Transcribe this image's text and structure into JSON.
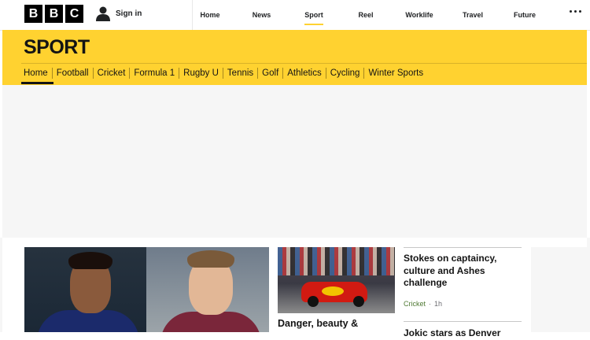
{
  "header": {
    "logo_letters": [
      "B",
      "B",
      "C"
    ],
    "sign_in": "Sign in",
    "nav": [
      {
        "label": "Home",
        "active": false
      },
      {
        "label": "News",
        "active": false
      },
      {
        "label": "Sport",
        "active": true
      },
      {
        "label": "Reel",
        "active": false
      },
      {
        "label": "Worklife",
        "active": false
      },
      {
        "label": "Travel",
        "active": false
      },
      {
        "label": "Future",
        "active": false
      }
    ],
    "more_icon": "more-dots-icon",
    "user_icon": "user-icon"
  },
  "sport": {
    "title": "SPORT",
    "subnav": [
      {
        "label": "Home",
        "active": true
      },
      {
        "label": "Football"
      },
      {
        "label": "Cricket"
      },
      {
        "label": "Formula 1"
      },
      {
        "label": "Rugby U"
      },
      {
        "label": "Tennis"
      },
      {
        "label": "Golf"
      },
      {
        "label": "Athletics"
      },
      {
        "label": "Cycling"
      },
      {
        "label": "Winter Sports"
      }
    ]
  },
  "stories": {
    "second": {
      "title": "Danger, beauty &"
    },
    "side1": {
      "title": "Stokes on captaincy, culture and Ashes challenge",
      "section": "Cricket",
      "separator": "·",
      "time": "1h"
    },
    "side2": {
      "title": "Jokic stars as Denver"
    }
  },
  "colors": {
    "accent": "#ffd230",
    "section_green": "#507a34"
  }
}
